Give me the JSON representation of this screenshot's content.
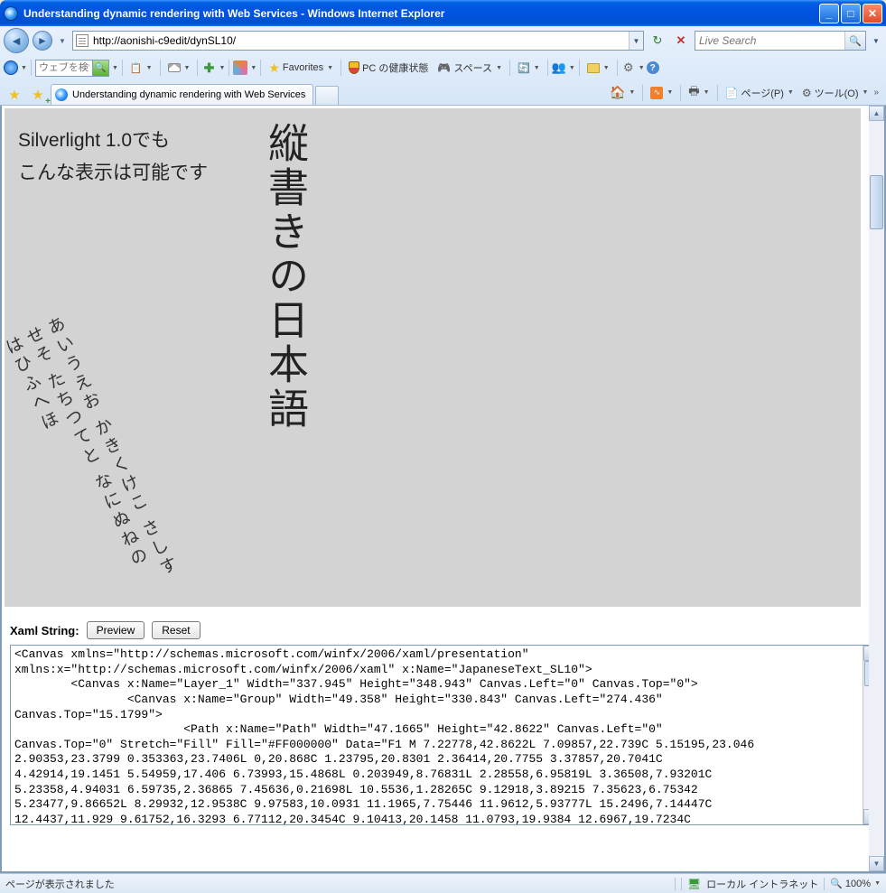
{
  "window": {
    "title": "Understanding dynamic rendering with Web Services - Windows Internet Explorer"
  },
  "nav": {
    "url": "http://aonishi-c9edit/dynSL10/",
    "search_placeholder": "Live Search"
  },
  "toolbar": {
    "websearch_placeholder": "ウェブを検索...",
    "favorites": "Favorites",
    "pc_health": "PC の健康状態",
    "space": "スペース"
  },
  "tab": {
    "title": "Understanding dynamic rendering with Web Services"
  },
  "cmdbar": {
    "page": "ページ(P)",
    "tool": "ツール(O)"
  },
  "content": {
    "sl_line1": "Silverlight 1.0でも",
    "sl_line2": "こんな表示は可能です",
    "vertical": "縦書きの日本語",
    "rot_c1": "あいうえお",
    "rot_c2": "かきくけこ",
    "rot_c3": "さしすせそ",
    "rot_c4": "たちつてと",
    "rot_c5": "なにぬねの",
    "rot_c6": "はひふへほ",
    "xaml_label": "Xaml String:",
    "btn_preview": "Preview",
    "btn_reset": "Reset",
    "xaml": "<Canvas xmlns=\"http://schemas.microsoft.com/winfx/2006/xaml/presentation\"\nxmlns:x=\"http://schemas.microsoft.com/winfx/2006/xaml\" x:Name=\"JapaneseText_SL10\">\n        <Canvas x:Name=\"Layer_1\" Width=\"337.945\" Height=\"348.943\" Canvas.Left=\"0\" Canvas.Top=\"0\">\n                <Canvas x:Name=\"Group\" Width=\"49.358\" Height=\"330.843\" Canvas.Left=\"274.436\"\nCanvas.Top=\"15.1799\">\n                        <Path x:Name=\"Path\" Width=\"47.1665\" Height=\"42.8622\" Canvas.Left=\"0\"\nCanvas.Top=\"0\" Stretch=\"Fill\" Fill=\"#FF000000\" Data=\"F1 M 7.22778,42.8622L 7.09857,22.739C 5.15195,23.046\n2.90353,23.3799 0.353363,23.7406L 0,20.868C 1.23795,20.8301 2.36414,20.7755 3.37857,20.7041C\n4.42914,19.1451 5.54959,17.406 6.73993,15.4868L 0.203949,8.76831L 2.28558,6.95819L 3.36508,7.93201C\n5.23358,4.94031 6.59735,2.36865 7.45636,0.21698L 10.5536,1.28265C 9.12918,3.89215 7.35623,6.75342\n5.23477,9.86652L 8.29932,12.9538C 9.97583,10.0931 11.1965,7.75446 11.9612,5.93777L 15.2496,7.14447C\n12.4437,11.929 9.61752,16.3293 6.77112,20.3454C 9.10413,20.1458 11.0793,19.9384 12.6967,19.7234C"
  },
  "status": {
    "text": "ページが表示されました",
    "zone": "ローカル イントラネット",
    "zoom": "100%"
  }
}
